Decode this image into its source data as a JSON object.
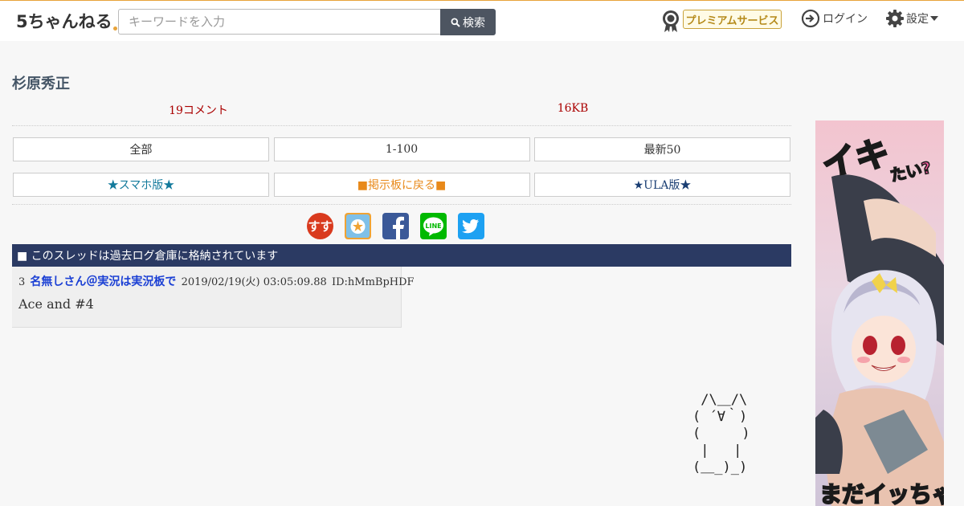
{
  "header": {
    "logo_text": "5ちゃんねる",
    "search_placeholder": "キーワードを入力",
    "search_button": "検索",
    "premium_label": "プレミアムサービス",
    "login_label": "ログイン",
    "settings_label": "設定"
  },
  "thread": {
    "title": "杉原秀正",
    "comments": "19コメント",
    "size": "16KB"
  },
  "nav": {
    "row1": [
      "全部",
      "1-100",
      "最新50"
    ],
    "row2": [
      "★スマホ版★",
      "■掲示板に戻る■",
      "★ULA版★"
    ]
  },
  "share": {
    "icons": [
      "sukusuku-icon",
      "bookmark-icon",
      "facebook-icon",
      "line-icon",
      "twitter-icon"
    ],
    "line_text": "LINE"
  },
  "notice": "■ このスレッドは過去ログ倉庫に格納されています",
  "post": {
    "number": "3",
    "name": "名無しさん＠実況は実況板で",
    "datetime": "2019/02/19(火) 03:05:09.88",
    "id": "ID:hMmBpHDF",
    "body": "Ace and #4"
  },
  "ad": {
    "text_top": "イキたい?",
    "text_bottom": "まだイッちゃ"
  },
  "ascii_art": " /\\＿/\\\n( ´∀｀)\n(     )\n |   |\n(＿_)_)",
  "colors": {
    "accent": "#e8a33a",
    "notice_bg": "#2b3a63",
    "link_teal": "#137a9c",
    "link_orange": "#e8891a",
    "link_navy": "#1a3e73",
    "post_name": "#1a3fd4",
    "meta_red": "#aa0000"
  }
}
